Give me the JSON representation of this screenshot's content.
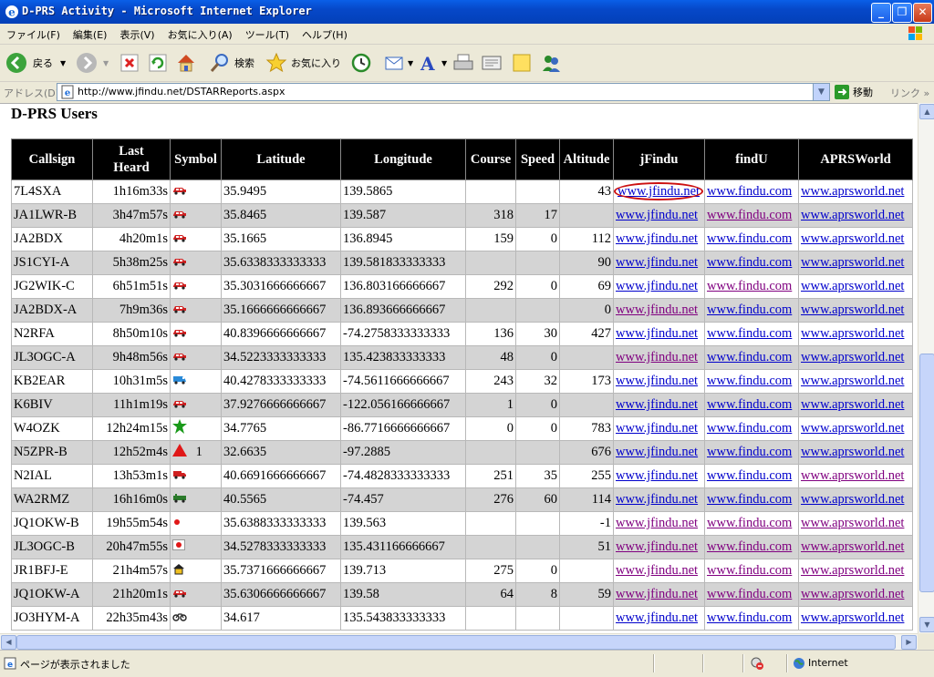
{
  "window": {
    "title": "D-PRS Activity - Microsoft Internet Explorer"
  },
  "menu": [
    "ファイル(F)",
    "編集(E)",
    "表示(V)",
    "お気に入り(A)",
    "ツール(T)",
    "ヘルプ(H)"
  ],
  "toolbar": {
    "back_label": "戻る",
    "search_label": "検索",
    "favorites_label": "お気に入り"
  },
  "address": {
    "label": "アドレス(D)",
    "url": "http://www.jfindu.net/DSTARReports.aspx",
    "go_label": "移動",
    "links_label": "リンク"
  },
  "page": {
    "title": "D-PRS Users"
  },
  "table": {
    "headers": [
      "Callsign",
      "Last Heard",
      "Symbol",
      "Latitude",
      "Longitude",
      "Course",
      "Speed",
      "Altitude",
      "jFindu",
      "findU",
      "APRSWorld"
    ],
    "link_text": {
      "jfindu": "www.jfindu.net",
      "findu": "www.findu.com",
      "aprsworld": "www.aprsworld.net"
    },
    "rows": [
      {
        "callsign": "7L4SXA",
        "heard": "1h16m33s",
        "symbol": "car-icon",
        "sym_text": "",
        "lat": "35.9495",
        "lon": "139.5865",
        "course": "",
        "speed": "",
        "alt": "43",
        "vj": false,
        "vf": false,
        "va": false
      },
      {
        "callsign": "JA1LWR-B",
        "heard": "3h47m57s",
        "symbol": "car-icon",
        "sym_text": "",
        "lat": "35.8465",
        "lon": "139.587",
        "course": "318",
        "speed": "17",
        "alt": "",
        "vj": false,
        "vf": true,
        "va": false
      },
      {
        "callsign": "JA2BDX",
        "heard": "4h20m1s",
        "symbol": "car-icon",
        "sym_text": "",
        "lat": "35.1665",
        "lon": "136.8945",
        "course": "159",
        "speed": "0",
        "alt": "112",
        "vj": false,
        "vf": false,
        "va": false
      },
      {
        "callsign": "JS1CYI-A",
        "heard": "5h38m25s",
        "symbol": "car-icon",
        "sym_text": "",
        "lat": "35.6338333333333",
        "lon": "139.581833333333",
        "course": "",
        "speed": "",
        "alt": "90",
        "vj": false,
        "vf": false,
        "va": false
      },
      {
        "callsign": "JG2WIK-C",
        "heard": "6h51m51s",
        "symbol": "car-icon",
        "sym_text": "",
        "lat": "35.3031666666667",
        "lon": "136.803166666667",
        "course": "292",
        "speed": "0",
        "alt": "69",
        "vj": false,
        "vf": true,
        "va": false
      },
      {
        "callsign": "JA2BDX-A",
        "heard": "7h9m36s",
        "symbol": "car-icon",
        "sym_text": "",
        "lat": "35.1666666666667",
        "lon": "136.893666666667",
        "course": "",
        "speed": "",
        "alt": "0",
        "vj": true,
        "vf": false,
        "va": false
      },
      {
        "callsign": "N2RFA",
        "heard": "8h50m10s",
        "symbol": "car-icon",
        "sym_text": "",
        "lat": "40.8396666666667",
        "lon": "-74.2758333333333",
        "course": "136",
        "speed": "30",
        "alt": "427",
        "vj": false,
        "vf": false,
        "va": false
      },
      {
        "callsign": "JL3OGC-A",
        "heard": "9h48m56s",
        "symbol": "car-icon",
        "sym_text": "",
        "lat": "34.5223333333333",
        "lon": "135.423833333333",
        "course": "48",
        "speed": "0",
        "alt": "",
        "vj": true,
        "vf": false,
        "va": false
      },
      {
        "callsign": "KB2EAR",
        "heard": "10h31m5s",
        "symbol": "van-icon",
        "sym_text": "",
        "lat": "40.4278333333333",
        "lon": "-74.5611666666667",
        "course": "243",
        "speed": "32",
        "alt": "173",
        "vj": false,
        "vf": false,
        "va": false
      },
      {
        "callsign": "K6BIV",
        "heard": "11h1m19s",
        "symbol": "car-icon",
        "sym_text": "",
        "lat": "37.9276666666667",
        "lon": "-122.056166666667",
        "course": "1",
        "speed": "0",
        "alt": "",
        "vj": false,
        "vf": false,
        "va": false
      },
      {
        "callsign": "W4OZK",
        "heard": "12h24m15s",
        "symbol": "star-icon",
        "sym_text": "",
        "lat": "34.7765",
        "lon": "-86.7716666666667",
        "course": "0",
        "speed": "0",
        "alt": "783",
        "vj": false,
        "vf": false,
        "va": false
      },
      {
        "callsign": "N5ZPR-B",
        "heard": "12h52m4s",
        "symbol": "triangle-icon",
        "sym_text": "1",
        "lat": "32.6635",
        "lon": "-97.2885",
        "course": "",
        "speed": "",
        "alt": "676",
        "vj": false,
        "vf": false,
        "va": false
      },
      {
        "callsign": "N2IAL",
        "heard": "13h53m1s",
        "symbol": "truck-icon",
        "sym_text": "",
        "lat": "40.6691666666667",
        "lon": "-74.4828333333333",
        "course": "251",
        "speed": "35",
        "alt": "255",
        "vj": false,
        "vf": false,
        "va": true
      },
      {
        "callsign": "WA2RMZ",
        "heard": "16h16m0s",
        "symbol": "jeep-icon",
        "sym_text": "",
        "lat": "40.5565",
        "lon": "-74.457",
        "course": "276",
        "speed": "60",
        "alt": "114",
        "vj": false,
        "vf": false,
        "va": false
      },
      {
        "callsign": "JQ1OKW-B",
        "heard": "19h55m54s",
        "symbol": "dot-icon",
        "sym_text": "",
        "lat": "35.6388333333333",
        "lon": "139.563",
        "course": "",
        "speed": "",
        "alt": "-1",
        "vj": true,
        "vf": true,
        "va": true
      },
      {
        "callsign": "JL3OGC-B",
        "heard": "20h47m55s",
        "symbol": "flag-icon",
        "sym_text": "",
        "lat": "34.5278333333333",
        "lon": "135.431166666667",
        "course": "",
        "speed": "",
        "alt": "51",
        "vj": true,
        "vf": true,
        "va": true
      },
      {
        "callsign": "JR1BFJ-E",
        "heard": "21h4m57s",
        "symbol": "house-icon",
        "sym_text": "",
        "lat": "35.7371666666667",
        "lon": "139.713",
        "course": "275",
        "speed": "0",
        "alt": "",
        "vj": true,
        "vf": true,
        "va": true
      },
      {
        "callsign": "JQ1OKW-A",
        "heard": "21h20m1s",
        "symbol": "car-icon",
        "sym_text": "",
        "lat": "35.6306666666667",
        "lon": "139.58",
        "course": "64",
        "speed": "8",
        "alt": "59",
        "vj": true,
        "vf": true,
        "va": true
      },
      {
        "callsign": "JO3HYM-A",
        "heard": "22h35m43s",
        "symbol": "bike-icon",
        "sym_text": "",
        "lat": "34.617",
        "lon": "135.543833333333",
        "course": "",
        "speed": "",
        "alt": "",
        "vj": false,
        "vf": false,
        "va": false
      }
    ]
  },
  "status": {
    "text": "ページが表示されました",
    "zone": "Internet"
  }
}
